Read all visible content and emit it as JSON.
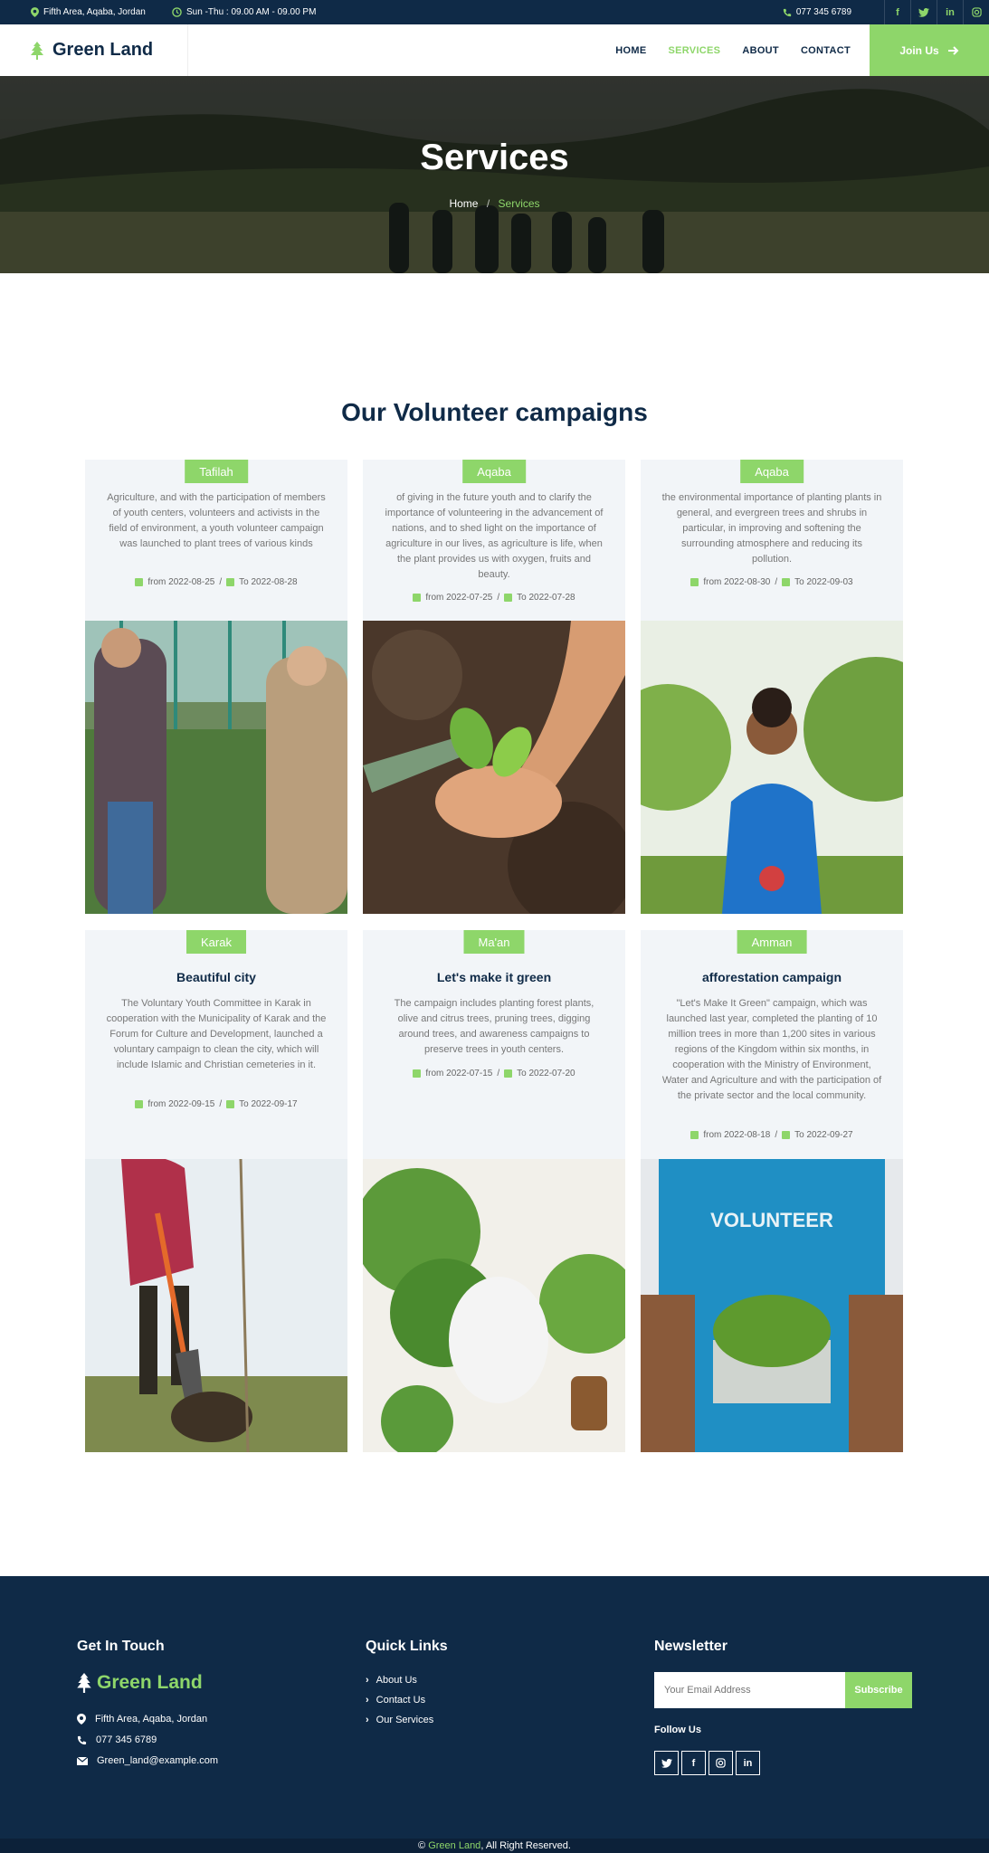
{
  "topbar": {
    "address": "Fifth Area, Aqaba, Jordan",
    "hours": "Sun -Thu : 09.00 AM - 09.00 PM",
    "phone": "077 345 6789",
    "social": [
      "facebook-icon",
      "twitter-icon",
      "linkedin-icon",
      "instagram-icon"
    ]
  },
  "nav": {
    "brand": "Green Land",
    "items": [
      "HOME",
      "SERVICES",
      "ABOUT",
      "CONTACT"
    ],
    "active": "SERVICES",
    "join": "Join Us"
  },
  "hero": {
    "title": "Services",
    "crumb_home": "Home",
    "crumb_sep": "/",
    "crumb_current": "Services"
  },
  "section": {
    "title": "Our Volunteer campaigns"
  },
  "cards": [
    {
      "city": "Tafilah",
      "title": "",
      "desc": "Agriculture, and with the participation of members of youth centers, volunteers and activists in the field of environment, a youth volunteer campaign was launched to plant trees of various kinds",
      "from": "from 2022-08-25",
      "to": "To 2022-08-28"
    },
    {
      "city": "Aqaba",
      "title": "",
      "desc": "of giving in the future youth and to clarify the importance of volunteering in the advancement of nations, and to shed light on the importance of agriculture in our lives, as agriculture is life, when the plant provides us with oxygen, fruits and beauty.",
      "from": "from 2022-07-25",
      "to": "To 2022-07-28"
    },
    {
      "city": "Aqaba",
      "title": "",
      "desc": "the environmental importance of planting plants in general, and evergreen trees and shrubs in particular, in improving and softening the surrounding atmosphere and reducing its pollution.",
      "from": "from 2022-08-30",
      "to": "To 2022-09-03"
    },
    {
      "city": "Karak",
      "title": "Beautiful city",
      "desc": "The Voluntary Youth Committee in Karak in cooperation with the Municipality of Karak and the Forum for Culture and Development, launched a voluntary campaign to clean the city, which will include Islamic and Christian cemeteries in it.",
      "from": "from 2022-09-15",
      "to": "To 2022-09-17"
    },
    {
      "city": "Ma'an",
      "title": "Let's make it green",
      "desc": "The campaign includes planting forest plants, olive and citrus trees, pruning trees, digging around trees, and awareness campaigns to preserve trees in youth centers.",
      "from": "from 2022-07-15",
      "to": "To 2022-07-20"
    },
    {
      "city": "Amman",
      "title": "afforestation campaign",
      "desc": "\"Let's Make It Green\" campaign, which was launched last year, completed the planting of 10 million trees in more than 1,200 sites in various regions of the Kingdom within six months, in cooperation with the Ministry of Environment, Water and Agriculture and with the participation of the private sector and the local community.",
      "from": "from 2022-08-18",
      "to": "To 2022-09-27"
    }
  ],
  "footer": {
    "touch_title": "Get In Touch",
    "brand": "Green Land",
    "address": "Fifth Area, Aqaba, Jordan",
    "phone": "077 345 6789",
    "email": "Green_land@example.com",
    "links_title": "Quick Links",
    "links": [
      "About Us",
      "Contact Us",
      "Our Services"
    ],
    "news_title": "Newsletter",
    "email_placeholder": "Your Email Address",
    "subscribe": "Subscribe",
    "follow": "Follow Us",
    "social": [
      "twitter-icon",
      "facebook-icon",
      "instagram-icon",
      "linkedin-icon"
    ]
  },
  "copyright": {
    "prefix": "© ",
    "brand": "Green Land",
    "suffix": ", All Right Reserved."
  },
  "colors": {
    "navy": "#0f2a47",
    "accent": "#8ed66a",
    "card_bg": "#f2f5f8"
  }
}
